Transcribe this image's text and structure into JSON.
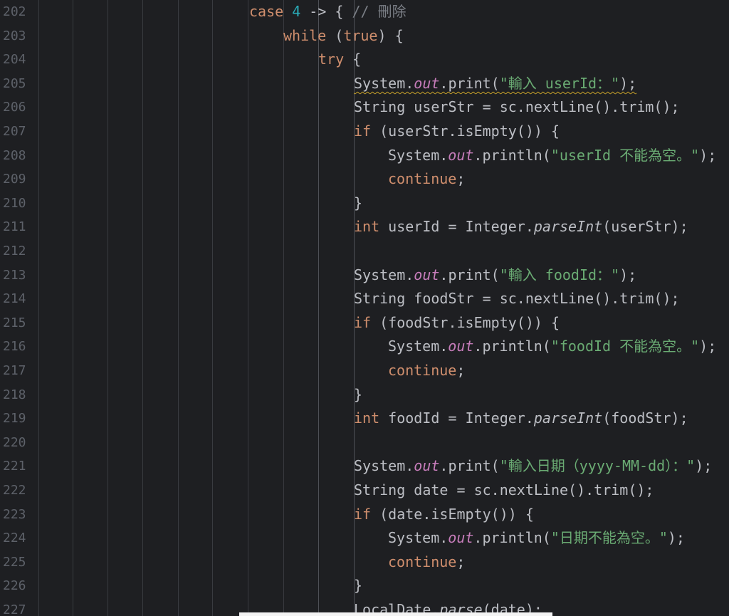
{
  "editor": {
    "theme_colors": {
      "background": "#1e1f22",
      "line_number": "#5d6169",
      "keyword": "#cf8e6d",
      "number": "#2aacb8",
      "comment": "#7a7e85",
      "string": "#6aab73",
      "field": "#c77dbb",
      "text": "#bcbec4"
    },
    "lines": [
      {
        "number": "202",
        "tokens": [
          {
            "t": "case",
            "c": "kw"
          },
          {
            "t": " "
          },
          {
            "t": "4",
            "c": "num"
          },
          {
            "t": " -> { "
          },
          {
            "t": "// 刪除",
            "c": "cmt"
          }
        ]
      },
      {
        "number": "203",
        "tokens": [
          {
            "t": "while",
            "c": "kw"
          },
          {
            "t": " ("
          },
          {
            "t": "true",
            "c": "kw"
          },
          {
            "t": ") {"
          }
        ]
      },
      {
        "number": "204",
        "tokens": [
          {
            "t": "try",
            "c": "kw"
          },
          {
            "t": " {"
          }
        ]
      },
      {
        "number": "205",
        "tokens": [
          {
            "t": "System.",
            "w": 1
          },
          {
            "t": "out",
            "c": "field",
            "w": 1
          },
          {
            "t": ".print(",
            "w": 1
          },
          {
            "t": "\"輸入 userId：\"",
            "c": "str",
            "w": 1
          },
          {
            "t": ");",
            "w": 1
          }
        ]
      },
      {
        "number": "206",
        "tokens": [
          {
            "t": "String userStr = sc.nextLine().trim();"
          }
        ]
      },
      {
        "number": "207",
        "tokens": [
          {
            "t": "if",
            "c": "kw"
          },
          {
            "t": " (userStr.isEmpty()) {"
          }
        ]
      },
      {
        "number": "208",
        "tokens": [
          {
            "t": "System."
          },
          {
            "t": "out",
            "c": "field"
          },
          {
            "t": ".println("
          },
          {
            "t": "\"userId 不能為空。\"",
            "c": "str"
          },
          {
            "t": ");"
          }
        ]
      },
      {
        "number": "209",
        "tokens": [
          {
            "t": "continue",
            "c": "kw"
          },
          {
            "t": ";"
          }
        ]
      },
      {
        "number": "210",
        "tokens": [
          {
            "t": "}"
          }
        ]
      },
      {
        "number": "211",
        "tokens": [
          {
            "t": "int",
            "c": "kw"
          },
          {
            "t": " userId = Integer."
          },
          {
            "t": "parseInt",
            "c": "static"
          },
          {
            "t": "(userStr);"
          }
        ]
      },
      {
        "number": "212",
        "tokens": []
      },
      {
        "number": "213",
        "tokens": [
          {
            "t": "System."
          },
          {
            "t": "out",
            "c": "field"
          },
          {
            "t": ".print("
          },
          {
            "t": "\"輸入 foodId：\"",
            "c": "str"
          },
          {
            "t": ");"
          }
        ]
      },
      {
        "number": "214",
        "tokens": [
          {
            "t": "String foodStr = sc.nextLine().trim();"
          }
        ]
      },
      {
        "number": "215",
        "tokens": [
          {
            "t": "if",
            "c": "kw"
          },
          {
            "t": " (foodStr.isEmpty()) {"
          }
        ]
      },
      {
        "number": "216",
        "tokens": [
          {
            "t": "System."
          },
          {
            "t": "out",
            "c": "field"
          },
          {
            "t": ".println("
          },
          {
            "t": "\"foodId 不能為空。\"",
            "c": "str"
          },
          {
            "t": ");"
          }
        ]
      },
      {
        "number": "217",
        "tokens": [
          {
            "t": "continue",
            "c": "kw"
          },
          {
            "t": ";"
          }
        ]
      },
      {
        "number": "218",
        "tokens": [
          {
            "t": "}"
          }
        ]
      },
      {
        "number": "219",
        "tokens": [
          {
            "t": "int",
            "c": "kw"
          },
          {
            "t": " foodId = Integer."
          },
          {
            "t": "parseInt",
            "c": "static"
          },
          {
            "t": "(foodStr);"
          }
        ]
      },
      {
        "number": "220",
        "tokens": []
      },
      {
        "number": "221",
        "tokens": [
          {
            "t": "System."
          },
          {
            "t": "out",
            "c": "field"
          },
          {
            "t": ".print("
          },
          {
            "t": "\"輸入日期（yyyy-MM-dd）：\"",
            "c": "str"
          },
          {
            "t": ");"
          }
        ]
      },
      {
        "number": "222",
        "tokens": [
          {
            "t": "String date = sc.nextLine().trim();"
          }
        ]
      },
      {
        "number": "223",
        "tokens": [
          {
            "t": "if",
            "c": "kw"
          },
          {
            "t": " (date.isEmpty()) {"
          }
        ]
      },
      {
        "number": "224",
        "tokens": [
          {
            "t": "System."
          },
          {
            "t": "out",
            "c": "field"
          },
          {
            "t": ".println("
          },
          {
            "t": "\"日期不能為空。\"",
            "c": "str"
          },
          {
            "t": ");"
          }
        ]
      },
      {
        "number": "225",
        "tokens": [
          {
            "t": "continue",
            "c": "kw"
          },
          {
            "t": ";"
          }
        ]
      },
      {
        "number": "226",
        "tokens": [
          {
            "t": "}"
          }
        ]
      },
      {
        "number": "227",
        "tokens": [
          {
            "t": "LocalDate."
          },
          {
            "t": "parse",
            "c": "static"
          },
          {
            "t": "(date);"
          }
        ]
      }
    ]
  }
}
